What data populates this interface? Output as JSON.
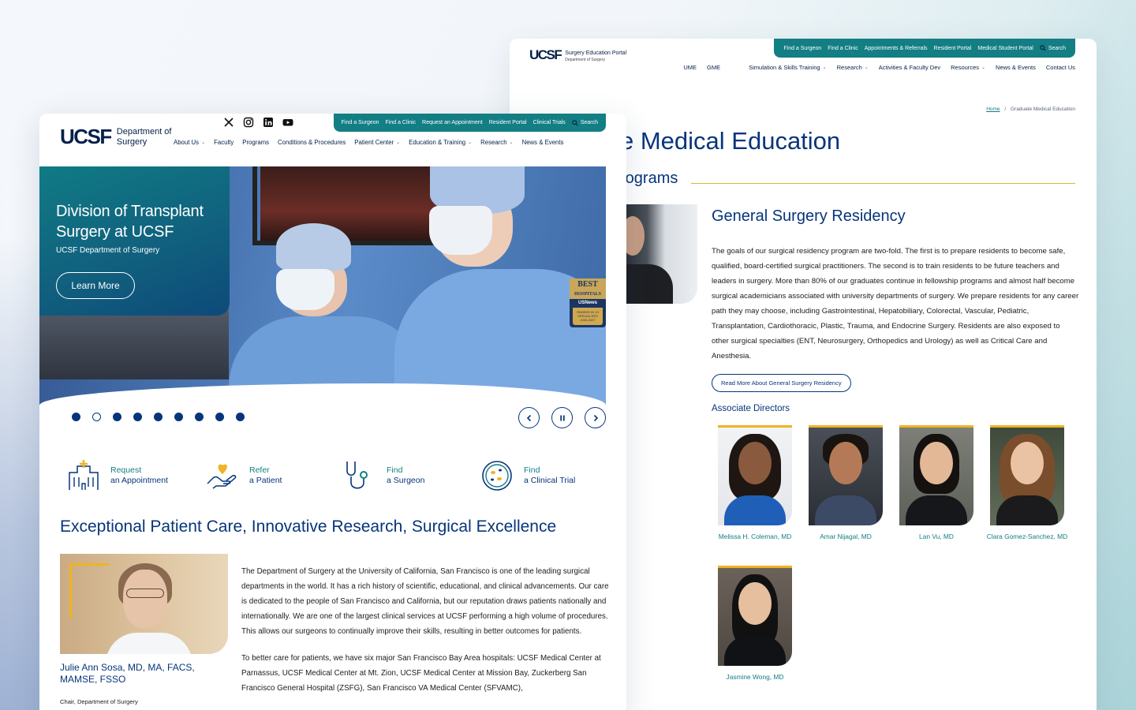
{
  "back": {
    "util_links": [
      "Find a Surgeon",
      "Find a Clinic",
      "Appointments & Referrals",
      "Resident Portal",
      "Medical Student Portal"
    ],
    "search_label": "Search",
    "logo_text": "UCSF",
    "portal_name": "Surgery Education Portal",
    "portal_dept": "Department of Surgery",
    "nav": {
      "ume": "UME",
      "gme": "GME",
      "simulation": "Simulation & Skills Training",
      "research": "Research",
      "activities": "Activities & Faculty Dev",
      "resources": "Resources",
      "news": "News & Events",
      "contact": "Contact Us"
    },
    "breadcrumb": {
      "home": "Home",
      "sep": "/",
      "current": "Graduate Medical Education"
    },
    "page_title": "e Medical Education",
    "section_title": "rograms",
    "program_title": "General Surgery Residency",
    "program_body": "The goals of our surgical residency program are two-fold. The first is to prepare residents to become safe, qualified, board-certified surgical practitioners. The second is to train residents to be future teachers and leaders in surgery. More than 80% of our graduates continue in fellowship programs and almost half become surgical academicians associated with university departments of surgery. We prepare residents for any career path they may choose, including Gastrointestinal, Hepatobiliary, Colorectal, Vascular, Pediatric, Transplantation, Cardiothoracic, Plastic, Trauma, and Endocrine Surgery. Residents are also exposed to other surgical specialties (ENT, Neurosurgery, Orthopedics and Urology) as well as Critical Care and Anesthesia.",
    "read_more": "Read More About General Surgery Residency",
    "assoc_title": "Associate Directors",
    "directors": [
      {
        "name": "Melissa H. Coleman, MD"
      },
      {
        "name": "Amar Nijagal, MD"
      },
      {
        "name": "Lan Vu, MD"
      },
      {
        "name": "Clara Gomez-Sanchez, MD"
      },
      {
        "name": "Jasmine Wong, MD"
      }
    ]
  },
  "front": {
    "util_links": [
      "Find a Surgeon",
      "Find a Clinic",
      "Request an Appointment",
      "Resident Portal",
      "Clinical Trials"
    ],
    "search_label": "Search",
    "social_icons": [
      "x-icon",
      "instagram-icon",
      "linkedin-icon",
      "youtube-icon"
    ],
    "logo_text": "UCSF",
    "dept_line1": "Department of",
    "dept_line2": "Surgery",
    "nav": {
      "about": "About Us",
      "faculty": "Faculty",
      "programs": "Programs",
      "conditions": "Conditions & Procedures",
      "patient": "Patient Center",
      "education": "Education & Training",
      "research": "Research",
      "news": "News & Events"
    },
    "hero": {
      "title": "Division of Transplant Surgery at UCSF",
      "subtitle": "UCSF Department of Surgery",
      "cta": "Learn More",
      "badge_line1": "BEST",
      "badge_line2": "HOSPITALS",
      "badge_line3": "USNews",
      "badge_line4": "RANKED IN 13 SPECIALTIES",
      "badge_line5": "2026-2027"
    },
    "carousel": {
      "slide_count": 9,
      "active_index": 1
    },
    "quick_links": [
      {
        "line1": "Request",
        "line2": "an Appointment",
        "icon": "hospital-icon"
      },
      {
        "line1": "Refer",
        "line2": "a Patient",
        "icon": "heart-hand-icon"
      },
      {
        "line1": "Find",
        "line2": "a Surgeon",
        "icon": "stethoscope-icon"
      },
      {
        "line1": "Find",
        "line2": "a Clinical Trial",
        "icon": "petri-dish-icon"
      }
    ],
    "headline": "Exceptional Patient Care, Innovative Research, Surgical Excellence",
    "chair_name": "Julie Ann Sosa, MD, MA, FACS, MAMSE, FSSO",
    "chair_role": "Chair, Department of Surgery",
    "body_p1": "The Department of Surgery at the University of California, San Francisco is one of the leading surgical departments in the world. It has a rich history of scientific, educational, and clinical advancements. Our care is dedicated to the people of San Francisco and California, but our reputation draws patients nationally and internationally. We are one of the largest clinical services at UCSF performing a high volume of procedures. This allows our surgeons to continually improve their skills, resulting in better outcomes for patients.",
    "body_p2": "To better care for patients, we have six major San Francisco Bay Area hospitals: UCSF Medical Center at Parnassus, UCSF Medical Center at Mt. Zion, UCSF Medical Center at Mission Bay, Zuckerberg San Francisco General Hospital (ZSFG), San Francisco VA Medical Center (SFVAMC),"
  },
  "colors": {
    "navy": "#07357b",
    "teal": "#137e83",
    "gold": "#f0b323"
  }
}
